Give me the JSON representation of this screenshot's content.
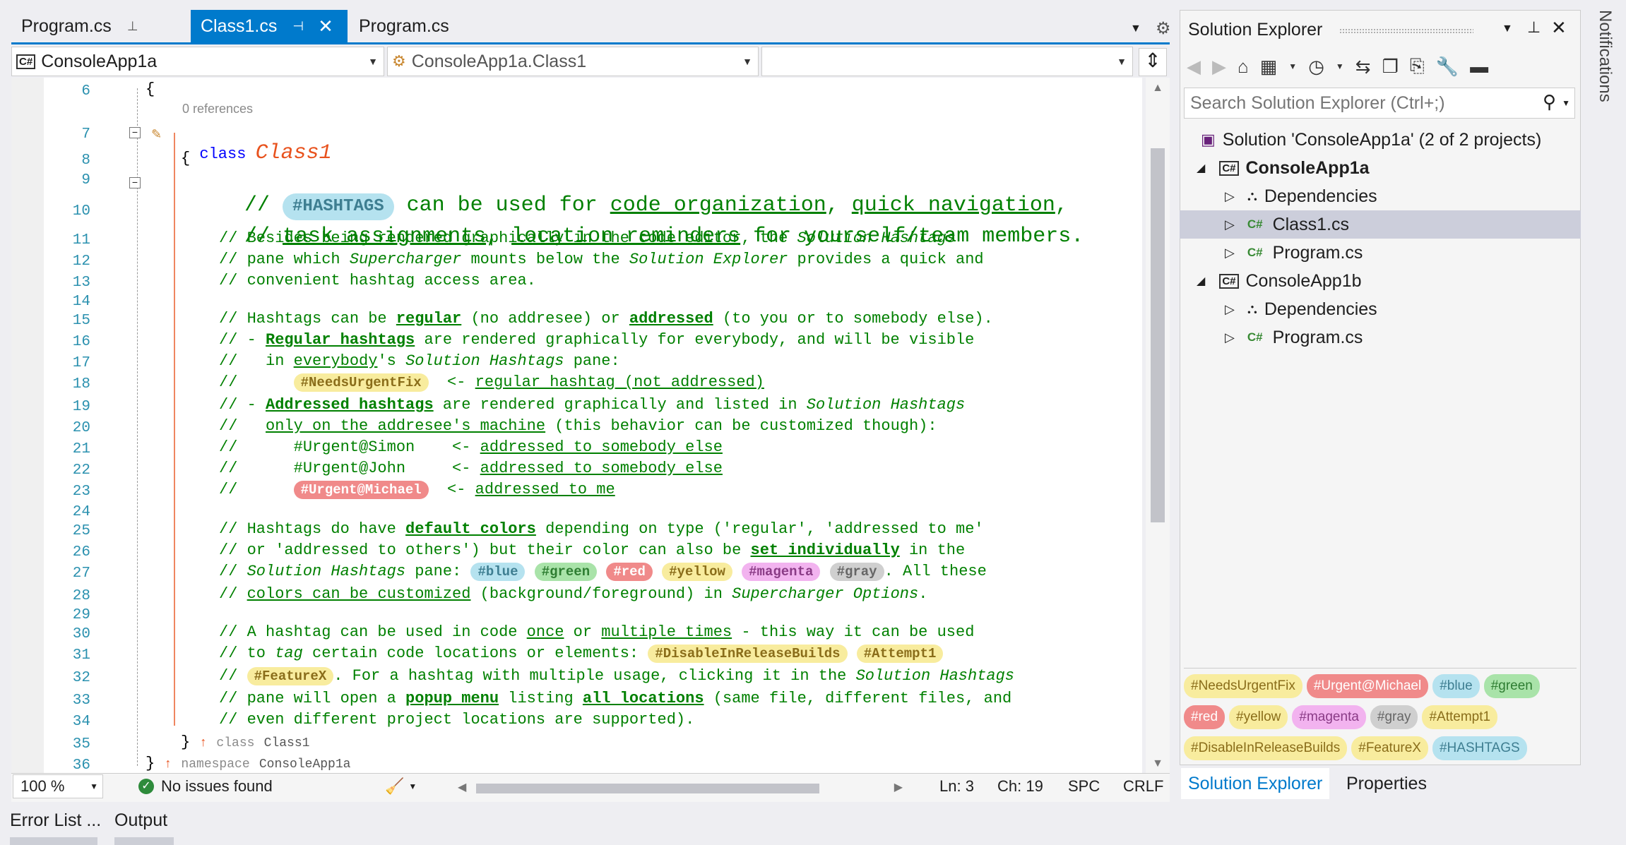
{
  "tabs": [
    {
      "label": "Program.cs",
      "state": "pinned"
    },
    {
      "label": "Class1.cs",
      "state": "active"
    },
    {
      "label": "Program.cs",
      "state": "preview"
    }
  ],
  "nav": {
    "project": "ConsoleApp1a",
    "type": "ConsoleApp1a.Class1",
    "member": ""
  },
  "editor": {
    "zoom": "100 %",
    "issues": "No issues found",
    "ln": "Ln: 3",
    "ch": "Ch: 19",
    "spc": "SPC",
    "crlf": "CRLF",
    "codelens": "0 references",
    "line_numbers": [
      "6",
      "7",
      "8",
      "9",
      "10",
      "11",
      "12",
      "13",
      "14",
      "15",
      "16",
      "17",
      "18",
      "19",
      "20",
      "21",
      "22",
      "23",
      "24",
      "25",
      "26",
      "27",
      "28",
      "29",
      "30",
      "31",
      "32",
      "33",
      "34",
      "35",
      "36"
    ],
    "l6": "{",
    "l7_kw": "class",
    "l7_name": "Class1",
    "l8": "{",
    "l9_pre": "// ",
    "l9_tag": "#HASHTAGS",
    "l9_mid": " can be used for ",
    "l9_u1": "code organization",
    "l9_c1": ", ",
    "l9_u2": "quick navigation",
    "l9_c2": ",",
    "l10_pre": "// ",
    "l10_u1": "task assignments",
    "l10_c1": ", ",
    "l10_u2": "location reminders",
    "l10_rest": " for yourself/team members.",
    "l11_a": "// Besides being rendered graphically in the code editor, the ",
    "l11_i": "Solution Hashtags",
    "l12_a": "// pane which ",
    "l12_i": "Supercharger",
    "l12_b": " mounts below the ",
    "l12_i2": "Solution Explorer",
    "l12_c": " provides a quick and",
    "l13": "// convenient hashtag access area.",
    "l15_a": "// Hashtags can be ",
    "l15_b1": "regular",
    "l15_m": " (no addresee) or ",
    "l15_b2": "addressed",
    "l15_e": " (to you or to somebody else).",
    "l16_a": "// - ",
    "l16_b": "Regular hashtags",
    "l16_e": " are rendered graphically for everybody, and will be visible",
    "l17_a": "//   in ",
    "l17_u": "everybody",
    "l17_m": "'s ",
    "l17_i": "Solution Hashtags",
    "l17_e": " pane:",
    "l18_a": "//      ",
    "l18_tag": "#NeedsUrgentFix",
    "l18_m": "  <- ",
    "l18_u": "regular hashtag (not addressed)",
    "l19_a": "// - ",
    "l19_b": "Addressed hashtags",
    "l19_m": " are rendered graphically and listed in ",
    "l19_i": "Solution Hashtags",
    "l20_a": "//   ",
    "l20_u": "only on the addresee's machine",
    "l20_e": " (this behavior can be customized though):",
    "l21_a": "//      #Urgent@Simon    <- ",
    "l21_u": "addressed to somebody else",
    "l22_a": "//      #Urgent@John     <- ",
    "l22_u": "addressed to somebody else",
    "l23_a": "//      ",
    "l23_tag": "#Urgent@Michael",
    "l23_m": "  <- ",
    "l23_u": "addressed to me",
    "l25_a": "// Hashtags do have ",
    "l25_b": "default colors",
    "l25_e": " depending on type ('regular', 'addressed to me'",
    "l26_a": "// or 'addressed to others') but their color can also be ",
    "l26_b": "set individually",
    "l26_e": " in the",
    "l27_a": "// ",
    "l27_i": "Solution Hashtags",
    "l27_m": " pane: ",
    "l27_tags": [
      "#blue",
      "#green",
      "#red",
      "#yellow",
      "#magenta",
      "#gray"
    ],
    "l27_e": ". All these",
    "l28_a": "// ",
    "l28_u": "colors can be customized",
    "l28_m": " (background/foreground) in ",
    "l28_i": "Supercharger Options",
    "l28_e": ".",
    "l30_a": "// A hashtag can be used in code ",
    "l30_u1": "once",
    "l30_m": " or ",
    "l30_u2": "multiple times",
    "l30_e": " - this way it can be used",
    "l31_a": "// to ",
    "l31_i": "tag",
    "l31_m": " certain code locations or elements: ",
    "l31_t1": "#DisableInReleaseBuilds",
    "l31_t2": "#Attempt1",
    "l32_a": "// ",
    "l32_t": "#FeatureX",
    "l32_m": ". For a hashtag with multiple usage, clicking it in the ",
    "l32_i": "Solution Hashtags",
    "l33_a": "// pane will open a ",
    "l33_b1": "popup menu",
    "l33_m": " listing ",
    "l33_b2": "all locations",
    "l33_e": " (same file, different files, and",
    "l34": "// even different project locations are supported).",
    "l35_brace": "}",
    "l35_arrow": "↑",
    "l35_kw": "class",
    "l35_name": "Class1",
    "l36_brace": "}",
    "l36_arrow": "↑",
    "l36_kw": "namespace",
    "l36_name": "ConsoleApp1a"
  },
  "solution_explorer": {
    "title": "Solution Explorer",
    "search_placeholder": "Search Solution Explorer (Ctrl+;)",
    "solution": "Solution 'ConsoleApp1a' (2 of 2 projects)",
    "items": [
      {
        "label": "ConsoleApp1a",
        "kind": "project",
        "bold": true
      },
      {
        "label": "Dependencies",
        "kind": "deps"
      },
      {
        "label": "Class1.cs",
        "kind": "cs",
        "selected": true
      },
      {
        "label": "Program.cs",
        "kind": "cs"
      },
      {
        "label": "ConsoleApp1b",
        "kind": "project"
      },
      {
        "label": "Dependencies",
        "kind": "deps"
      },
      {
        "label": "Program.cs",
        "kind": "cs"
      }
    ],
    "hashtags": [
      "#NeedsUrgentFix",
      "#Urgent@Michael",
      "#blue",
      "#green",
      "#red",
      "#yellow",
      "#magenta",
      "#gray",
      "#Attempt1",
      "#DisableInReleaseBuilds",
      "#FeatureX",
      "#HASHTAGS"
    ],
    "bottom_tabs": [
      "Solution Explorer",
      "Properties"
    ]
  },
  "notifications_label": "Notifications",
  "bottom_tabs": [
    "Error List ...",
    "Output"
  ],
  "colors": {
    "accent": "#007acc",
    "comment": "#008000",
    "linenum": "#2b91af",
    "tag_blue": "#b5e2ef",
    "tag_green": "#a9e3a9",
    "tag_red": "#f08a8a",
    "tag_yellow": "#f8ec9e",
    "tag_magenta": "#f2b3ef",
    "tag_gray": "#cfcfcf"
  }
}
